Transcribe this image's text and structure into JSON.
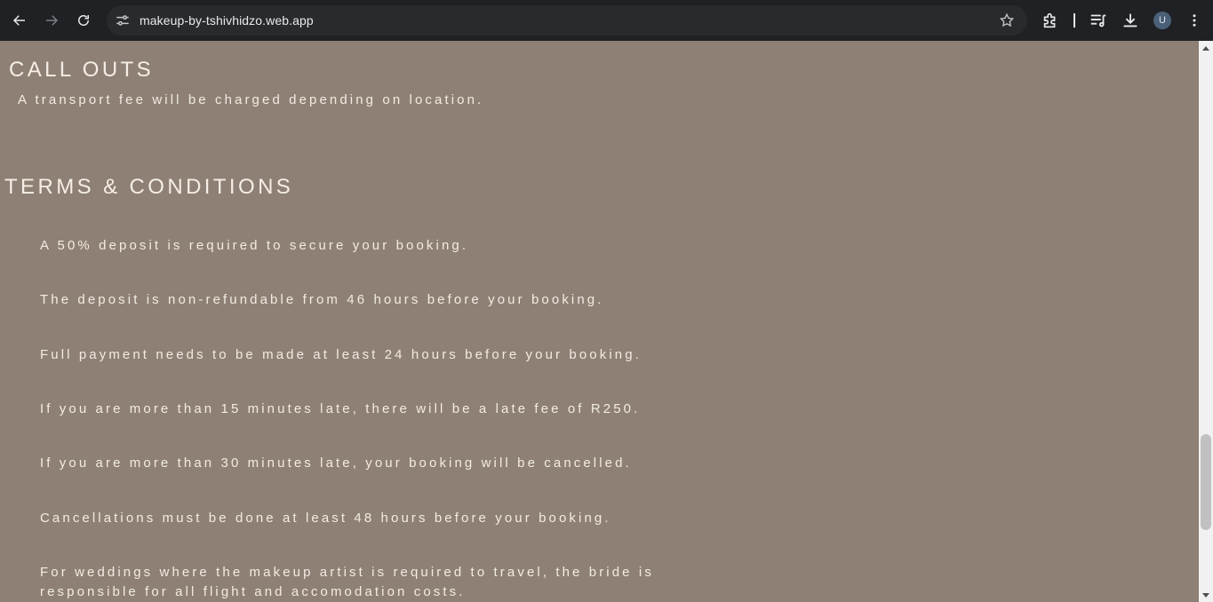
{
  "browser": {
    "url": "makeup-by-tshivhidzo.web.app",
    "avatar_letter": "U",
    "icons": [
      "back-icon",
      "forward-icon",
      "reload-icon",
      "site-info-icon",
      "star-icon",
      "extensions-icon",
      "reading-list-icon",
      "download-icon",
      "menu-icon"
    ]
  },
  "callouts": {
    "title": "CALL OUTS",
    "text": "A transport fee will be charged depending on location."
  },
  "terms": {
    "title": "TERMS & CONDITIONS",
    "items": [
      "A 50% deposit is required to secure your booking.",
      "The deposit is non-refundable from 46 hours before your booking.",
      "Full payment needs to be made at least 24 hours before your booking.",
      "If you are more than 15 minutes late, there will be a late fee of R250.",
      "If you are more than 30 minutes late, your booking will be cancelled.",
      "Cancellations must be done at least 48 hours before your booking.",
      "For weddings where the makeup artist is required to travel, the bride is responsible for all flight and accomodation costs."
    ]
  },
  "colors": {
    "page_background": "#8e8074",
    "text": "#f3ebe2",
    "browser_chrome": "#202124"
  }
}
